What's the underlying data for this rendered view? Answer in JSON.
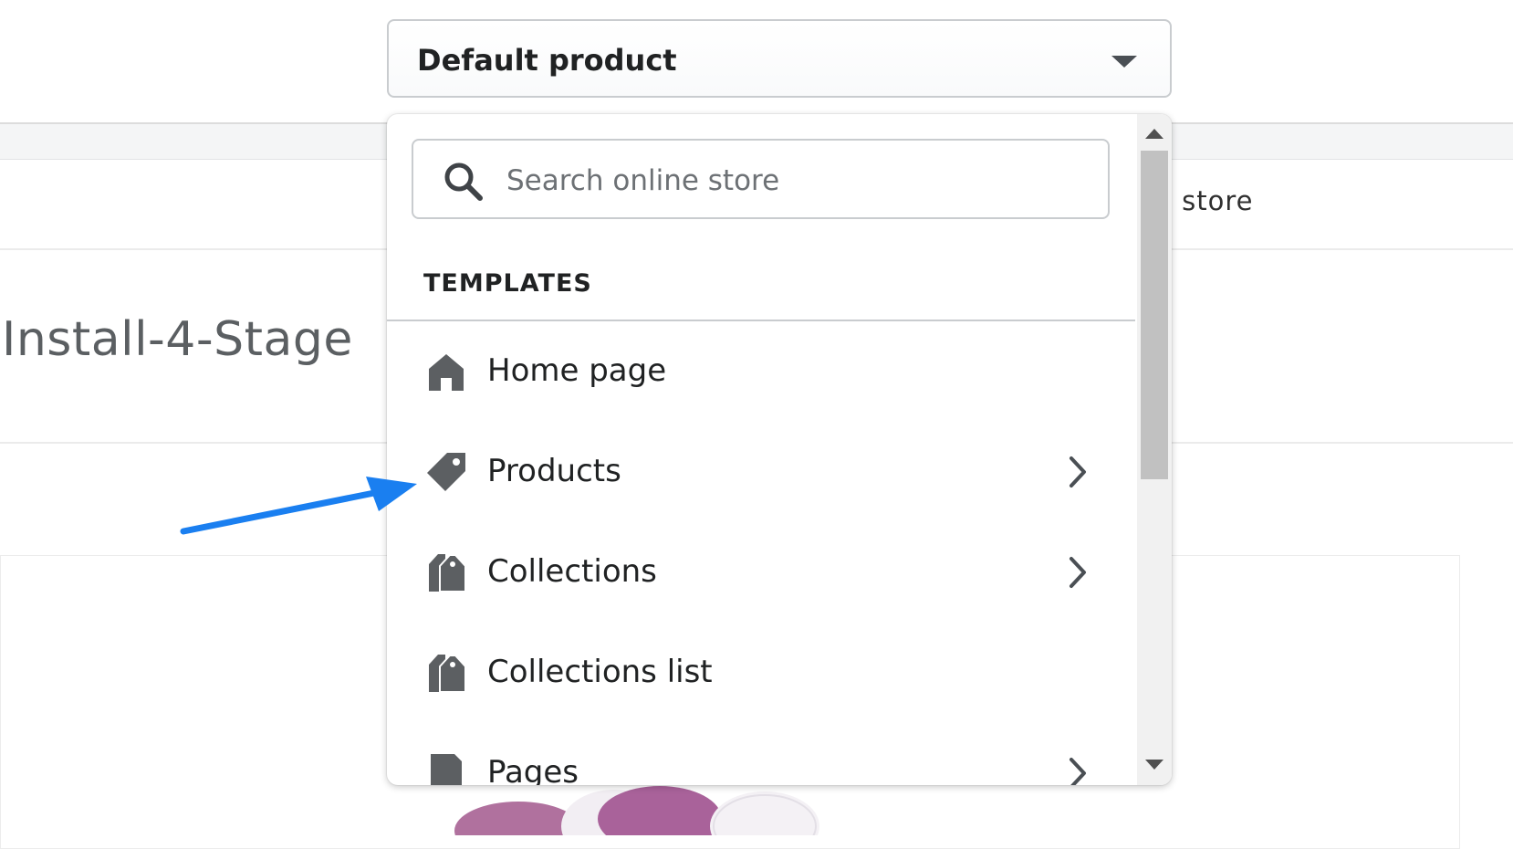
{
  "background": {
    "store_link_fragment": "r store",
    "page_heading": "Install-4-Stage"
  },
  "template_select": {
    "value": "Default product"
  },
  "dropdown": {
    "search": {
      "placeholder": "Search online store",
      "value": ""
    },
    "section_heading": "TEMPLATES",
    "items": [
      {
        "label": "Home page",
        "icon": "home-icon",
        "has_submenu": false
      },
      {
        "label": "Products",
        "icon": "tag-icon",
        "has_submenu": true
      },
      {
        "label": "Collections",
        "icon": "collections-icon",
        "has_submenu": true
      },
      {
        "label": "Collections list",
        "icon": "collections-icon",
        "has_submenu": false
      },
      {
        "label": "Pages",
        "icon": "page-icon",
        "has_submenu": true
      }
    ]
  },
  "colors": {
    "icon": "#5c5f62",
    "annotation_arrow": "#1a7ff0"
  }
}
